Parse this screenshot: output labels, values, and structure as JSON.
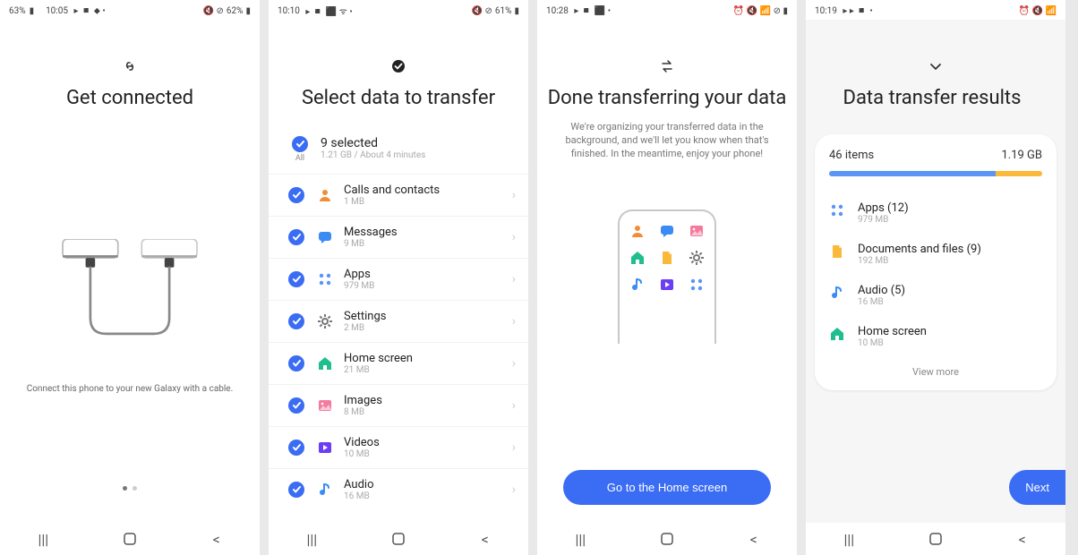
{
  "screens": [
    {
      "statusbar": {
        "battery_text": "63%",
        "time": "10:05",
        "right_text": "62%"
      },
      "title": "Get connected",
      "instruction": "Connect this phone to your new Galaxy with a cable."
    },
    {
      "statusbar": {
        "time": "10:10",
        "right_text": "61%"
      },
      "title": "Select data to transfer",
      "all_label": "All",
      "summary": {
        "title": "9 selected",
        "sub": "1.21 GB / About 4 minutes"
      },
      "items": [
        {
          "icon": "contact",
          "title": "Calls and contacts",
          "sub": "1 MB"
        },
        {
          "icon": "message",
          "title": "Messages",
          "sub": "9 MB"
        },
        {
          "icon": "apps",
          "title": "Apps",
          "sub": "979 MB"
        },
        {
          "icon": "settings",
          "title": "Settings",
          "sub": "2 MB"
        },
        {
          "icon": "home",
          "title": "Home screen",
          "sub": "21 MB"
        },
        {
          "icon": "images",
          "title": "Images",
          "sub": "8 MB"
        },
        {
          "icon": "videos",
          "title": "Videos",
          "sub": "10 MB"
        },
        {
          "icon": "audio",
          "title": "Audio",
          "sub": "16 MB"
        }
      ]
    },
    {
      "statusbar": {
        "time": "10:28"
      },
      "title": "Done transferring your data",
      "subtitle": "We're organizing your transferred data in the background, and we'll let you know when that's finished. In the meantime, enjoy your phone!",
      "cta": "Go to the Home screen"
    },
    {
      "statusbar": {
        "time": "10:19"
      },
      "title": "Data transfer results",
      "card_head": {
        "items": "46 items",
        "size": "1.19 GB"
      },
      "results": [
        {
          "icon": "apps",
          "title": "Apps (12)",
          "sub": "979 MB"
        },
        {
          "icon": "doc",
          "title": "Documents and files (9)",
          "sub": "192 MB"
        },
        {
          "icon": "audio",
          "title": "Audio (5)",
          "sub": "16 MB"
        },
        {
          "icon": "home",
          "title": "Home screen",
          "sub": "10 MB"
        }
      ],
      "view_more": "View more",
      "cta": "Next"
    }
  ]
}
